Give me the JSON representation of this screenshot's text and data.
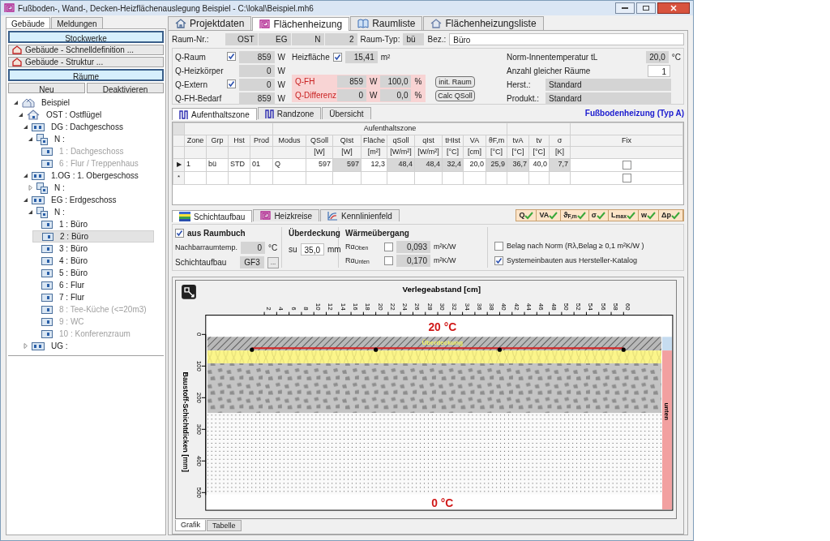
{
  "window": {
    "title": "Fußboden-, Wand-, Decken-Heizflächenauslegung Beispiel - C:\\lokal\\Beispiel.mh6"
  },
  "left_tabs": [
    {
      "label": "Gebäude",
      "selected": true
    },
    {
      "label": "Meldungen",
      "selected": false
    }
  ],
  "left_buttons": [
    {
      "label": "Stockwerke",
      "kind": "header"
    },
    {
      "label": "Gebäude - Schnelldefinition ...",
      "kind": "action"
    },
    {
      "label": "Gebäude - Struktur ...",
      "kind": "action"
    },
    {
      "label": "Räume",
      "kind": "header"
    }
  ],
  "room_buttons": [
    "Neu",
    "Deaktivieren"
  ],
  "tree": [
    {
      "label": "Beispiel",
      "kind": "project",
      "expanded": true,
      "selected": false,
      "disabled": false,
      "children": [
        {
          "label": "OST : Ostflügel",
          "kind": "wing",
          "expanded": true,
          "selected": false,
          "disabled": false,
          "children": [
            {
              "label": "DG : Dachgeschoss",
              "kind": "floor",
              "expanded": true,
              "selected": false,
              "disabled": false,
              "children": [
                {
                  "label": "N :",
                  "kind": "unit",
                  "expanded": true,
                  "selected": false,
                  "disabled": false,
                  "children": [
                    {
                      "label": "1 : Dachgeschoss",
                      "kind": "room",
                      "selected": false,
                      "disabled": true
                    },
                    {
                      "label": "6 : Flur / Treppenhaus",
                      "kind": "room",
                      "selected": false,
                      "disabled": true
                    }
                  ]
                }
              ]
            },
            {
              "label": "1.OG : 1. Obergeschoss",
              "kind": "floor",
              "expanded": true,
              "selected": false,
              "disabled": false,
              "children": [
                {
                  "label": "N :",
                  "kind": "unit",
                  "expanded": false,
                  "selected": false,
                  "disabled": false
                }
              ]
            },
            {
              "label": "EG : Erdgeschoss",
              "kind": "floor",
              "expanded": true,
              "selected": false,
              "disabled": false,
              "children": [
                {
                  "label": "N :",
                  "kind": "unit",
                  "expanded": true,
                  "selected": false,
                  "disabled": false,
                  "children": [
                    {
                      "label": "1 : Büro",
                      "kind": "room",
                      "selected": false,
                      "disabled": false
                    },
                    {
                      "label": "2 : Büro",
                      "kind": "room",
                      "selected": true,
                      "disabled": false
                    },
                    {
                      "label": "3 : Büro",
                      "kind": "room",
                      "selected": false,
                      "disabled": false
                    },
                    {
                      "label": "4 : Büro",
                      "kind": "room",
                      "selected": false,
                      "disabled": false
                    },
                    {
                      "label": "5 : Büro",
                      "kind": "room",
                      "selected": false,
                      "disabled": false
                    },
                    {
                      "label": "6 : Flur",
                      "kind": "room",
                      "selected": false,
                      "disabled": false
                    },
                    {
                      "label": "7 : Flur",
                      "kind": "room",
                      "selected": false,
                      "disabled": false
                    },
                    {
                      "label": "8 : Tee-Küche (<=20m3)",
                      "kind": "room",
                      "selected": false,
                      "disabled": true
                    },
                    {
                      "label": "9 : WC",
                      "kind": "room",
                      "selected": false,
                      "disabled": true
                    },
                    {
                      "label": "10 : Konferenzraum",
                      "kind": "room",
                      "selected": false,
                      "disabled": true
                    }
                  ]
                }
              ]
            },
            {
              "label": "UG :",
              "kind": "floor",
              "expanded": false,
              "selected": false,
              "disabled": false
            }
          ]
        }
      ]
    }
  ],
  "main_tabs": [
    {
      "label": "Projektdaten",
      "selected": false
    },
    {
      "label": "Flächenheizung",
      "selected": true
    },
    {
      "label": "Raumliste",
      "selected": false
    },
    {
      "label": "Flächenheizungsliste",
      "selected": false
    }
  ],
  "room": {
    "label": "Raum-Nr.:",
    "parts": [
      "OST",
      "EG",
      "N",
      "2"
    ],
    "type_label": "Raum-Typ:",
    "type": "bü",
    "name_label": "Bez.:",
    "name": "Büro"
  },
  "loads": [
    {
      "label": "Q-Raum",
      "kind": "checkbox",
      "checked": true,
      "value": "859",
      "unit": "W"
    },
    {
      "label": "Q-Heizkörper",
      "kind": "plain",
      "value": "0",
      "unit": "W"
    },
    {
      "label": "Q-Extern",
      "kind": "checkbox",
      "checked": true,
      "value": "0",
      "unit": "W"
    },
    {
      "label": "Q-FH-Bedarf",
      "kind": "plain",
      "value": "859",
      "unit": "W"
    }
  ],
  "surface": {
    "label": "Heizfläche",
    "checked": true,
    "value": "15,41",
    "unit": "m²"
  },
  "fh": [
    {
      "label": "Q-FH",
      "value": "859",
      "unit": "W",
      "percent": "100,0",
      "percent_unit": "%"
    },
    {
      "label": "Q-Differenz",
      "value": "0",
      "unit": "W",
      "percent": "0,0",
      "percent_unit": "%"
    }
  ],
  "actions": [
    "init. Raum",
    "Calc QSoll"
  ],
  "props": [
    {
      "label": "Norm-Innentemperatur tL",
      "kind": "readonly",
      "value": "20,0",
      "unit": "°C"
    },
    {
      "label": "Anzahl gleicher Räume",
      "kind": "input",
      "value": "1"
    },
    {
      "label": "Herst.:",
      "kind": "wide",
      "value": "Standard"
    },
    {
      "label": "Produkt.:",
      "kind": "wide",
      "value": "Standard"
    }
  ],
  "zone_tabs": [
    {
      "label": "Aufenthaltszone",
      "selected": true
    },
    {
      "label": "Randzone",
      "selected": false
    },
    {
      "label": "Übersicht",
      "selected": false
    }
  ],
  "heating_type": "Fußbodenheizung (Typ A)",
  "table": {
    "group_header": "Aufenthaltszone",
    "columns": [
      {
        "name": "Zone"
      },
      {
        "name": "Grp"
      },
      {
        "name": "Hst"
      },
      {
        "name": "Prod"
      },
      {
        "name": "Modus"
      },
      {
        "name": "QSoll",
        "unit": "[W]"
      },
      {
        "name": "QIst",
        "unit": "[W]"
      },
      {
        "name": "Fläche",
        "unit": "[m²]"
      },
      {
        "name": "qSoll",
        "unit": "[W/m²]"
      },
      {
        "name": "qIst",
        "unit": "[W/m²]"
      },
      {
        "name": "tHIst",
        "unit": "[°C]"
      },
      {
        "name": "VA",
        "unit": "[cm]"
      },
      {
        "name": "ϑF,m",
        "unit": "[°C]"
      },
      {
        "name": "tvA",
        "unit": "[°C]"
      },
      {
        "name": "tv",
        "unit": "[°C]"
      },
      {
        "name": "σ",
        "unit": "[K]"
      },
      {
        "name": "Fix"
      }
    ],
    "rows": [
      {
        "marker": "▶",
        "fix": false,
        "cells": [
          {
            "text": "1",
            "readonly": false
          },
          {
            "text": "bü",
            "readonly": false
          },
          {
            "text": "STD",
            "readonly": false
          },
          {
            "text": "01",
            "readonly": false
          },
          {
            "text": "Q",
            "readonly": false
          },
          {
            "text": "597",
            "readonly": false
          },
          {
            "text": "597",
            "readonly": true
          },
          {
            "text": "12,3",
            "readonly": false
          },
          {
            "text": "48,4",
            "readonly": true
          },
          {
            "text": "48,4",
            "readonly": true
          },
          {
            "text": "32,4",
            "readonly": true
          },
          {
            "text": "20,0",
            "readonly": false
          },
          {
            "text": "25,9",
            "readonly": true
          },
          {
            "text": "36,7",
            "readonly": true
          },
          {
            "text": "40,0",
            "readonly": false
          },
          {
            "text": "7,7",
            "readonly": true
          }
        ]
      },
      {
        "marker": "*",
        "fix": false
      }
    ]
  },
  "layer_tabs": [
    {
      "label": "Schichtaufbau",
      "selected": true
    },
    {
      "label": "Heizkreise",
      "selected": false
    },
    {
      "label": "Kennlinienfeld",
      "selected": false
    }
  ],
  "checks": [
    {
      "label": "Q",
      "ok": true
    },
    {
      "label": "VA",
      "ok": true
    },
    {
      "label": "ϑ$_{F,m}$",
      "ok": true
    },
    {
      "label": "σ",
      "ok": true
    },
    {
      "label": "L$_{max}$",
      "ok": true
    },
    {
      "label": "w",
      "ok": true
    },
    {
      "label": "Δp",
      "ok": true
    }
  ],
  "layers": {
    "from_book": {
      "label": "aus Raumbuch",
      "checked": true
    },
    "neighbor": {
      "label": "Nachbarraumtemp.",
      "value": "0",
      "unit": "°C"
    },
    "build": {
      "label": "Schichtaufbau",
      "value": "GF3",
      "button": "..."
    },
    "cover": {
      "title": "Überdeckung",
      "label": "su",
      "value": "35,0",
      "unit": "mm"
    },
    "transfer": {
      "title": "Wärmeübergang",
      "rows": [
        {
          "label": "Rα$_{Oben}$",
          "checked": false,
          "value": "0,093",
          "unit": "m²K/W"
        },
        {
          "label": "Rα$_{Unten}$",
          "checked": false,
          "value": "0,170",
          "unit": "m²K/W"
        }
      ]
    },
    "options": [
      {
        "label": "Belag nach Norm (Rλ,Belag ≥  0,1 m²K/W )",
        "checked": false
      },
      {
        "label": "Systemeinbauten aus Hersteller-Katalog",
        "checked": true
      }
    ]
  },
  "diagram": {
    "title": "Verlegeabstand [cm]",
    "ylabel": "Baustoff-Schichtdicken [mm]",
    "x_ticks": [
      "2",
      "4",
      "6",
      "8",
      "10",
      "12",
      "14",
      "16",
      "18",
      "20",
      "22",
      "24",
      "26",
      "28",
      "30",
      "32",
      "34",
      "36",
      "38",
      "40",
      "42",
      "44",
      "46",
      "48",
      "50",
      "52",
      "54",
      "56",
      "58",
      "60"
    ],
    "y_ticks": [
      "0",
      "100",
      "200",
      "300",
      "400",
      "500"
    ],
    "top_temp": "20 °C",
    "bottom_temp": "0 °C",
    "layer_label": "Überdeckung",
    "side_label": "unten"
  },
  "view_tabs": [
    {
      "label": "Grafik",
      "selected": true
    },
    {
      "label": "Tabelle",
      "selected": false
    }
  ]
}
